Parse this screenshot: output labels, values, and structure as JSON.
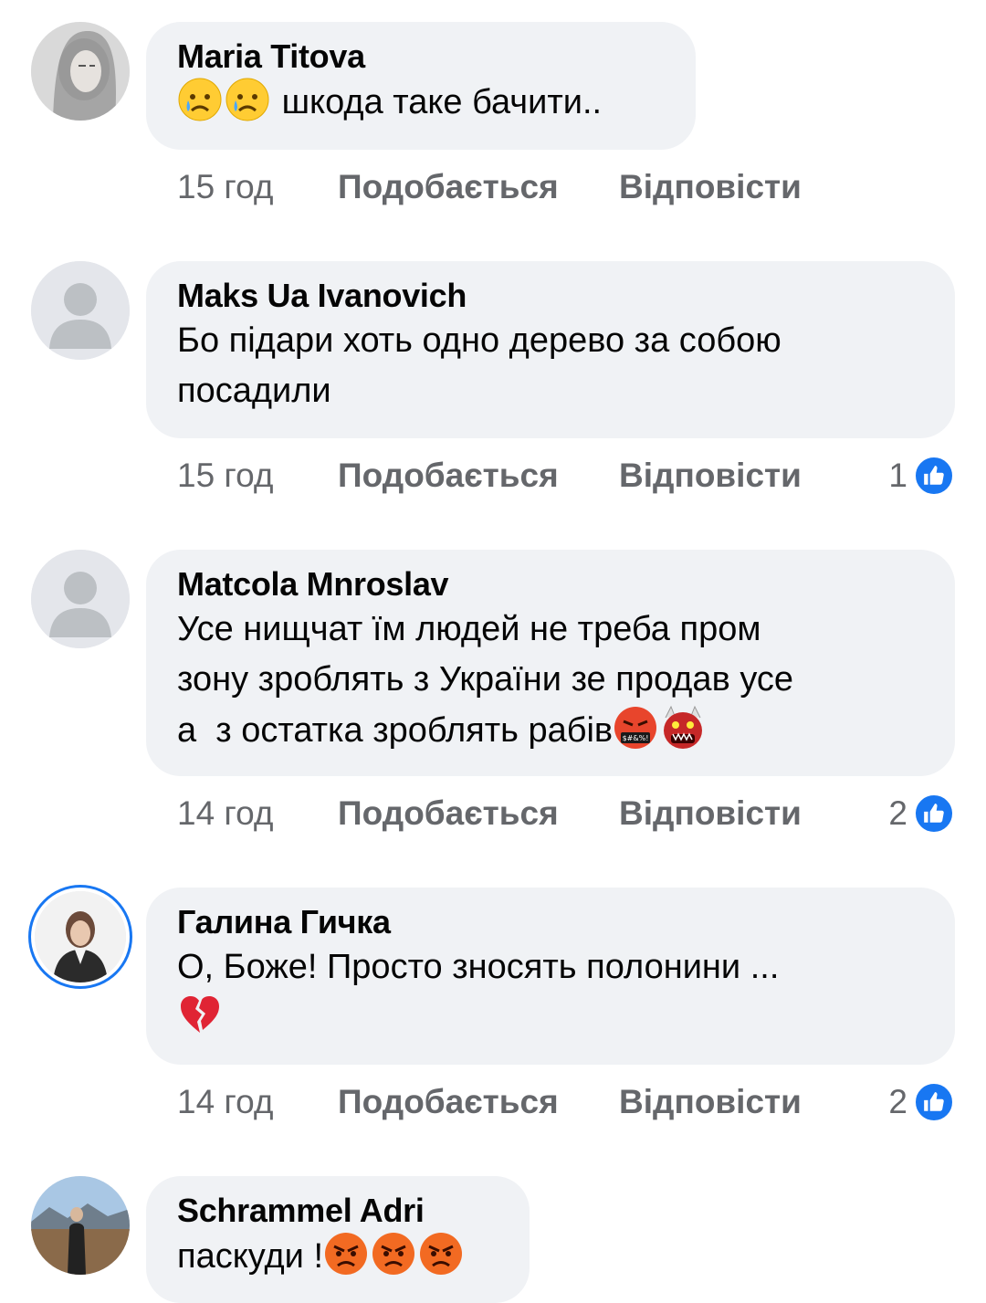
{
  "colors": {
    "bubble": "#f0f2f5",
    "meta": "#65676b",
    "accent": "#1877f2"
  },
  "comments": [
    {
      "author": "Maria Titova",
      "text_lines": [
        "шкода таке бачити.."
      ],
      "emojis_before": [
        "sad-tear-emoji",
        "sad-tear-emoji"
      ],
      "time": "15 год",
      "like_label": "Подобається",
      "reply_label": "Відповісти",
      "reaction_count": ""
    },
    {
      "author": "Maks Ua Ivanovich",
      "text_lines": [
        "Бо підари хоть одно дерево за собою",
        "посадили"
      ],
      "time": "15 год",
      "like_label": "Подобається",
      "reply_label": "Відповісти",
      "reaction_count": "1",
      "reaction_icon": "like-icon"
    },
    {
      "author": "Matcola Mnroslav",
      "text_lines": [
        "Усе нищчат їм людей не треба пром",
        "зону зроблять з України зе продав усе",
        "а  з остатка зроблять рабів"
      ],
      "emojis_after": [
        "cursing-face-emoji",
        "ogre-emoji"
      ],
      "time": "14 год",
      "like_label": "Подобається",
      "reply_label": "Відповісти",
      "reaction_count": "2",
      "reaction_icon": "like-icon"
    },
    {
      "author": "Галина Гичка",
      "text_lines": [
        "О, Боже! Просто зносять полонини ..."
      ],
      "emoji_line": [
        "broken-heart-emoji"
      ],
      "time": "14 год",
      "like_label": "Подобається",
      "reply_label": "Відповісти",
      "reaction_count": "2",
      "reaction_icon": "like-icon"
    },
    {
      "author": "Schrammel Adri",
      "text_lines": [
        "паскуди !"
      ],
      "emojis_after": [
        "angry-face-emoji",
        "angry-face-emoji",
        "angry-face-emoji"
      ]
    }
  ]
}
